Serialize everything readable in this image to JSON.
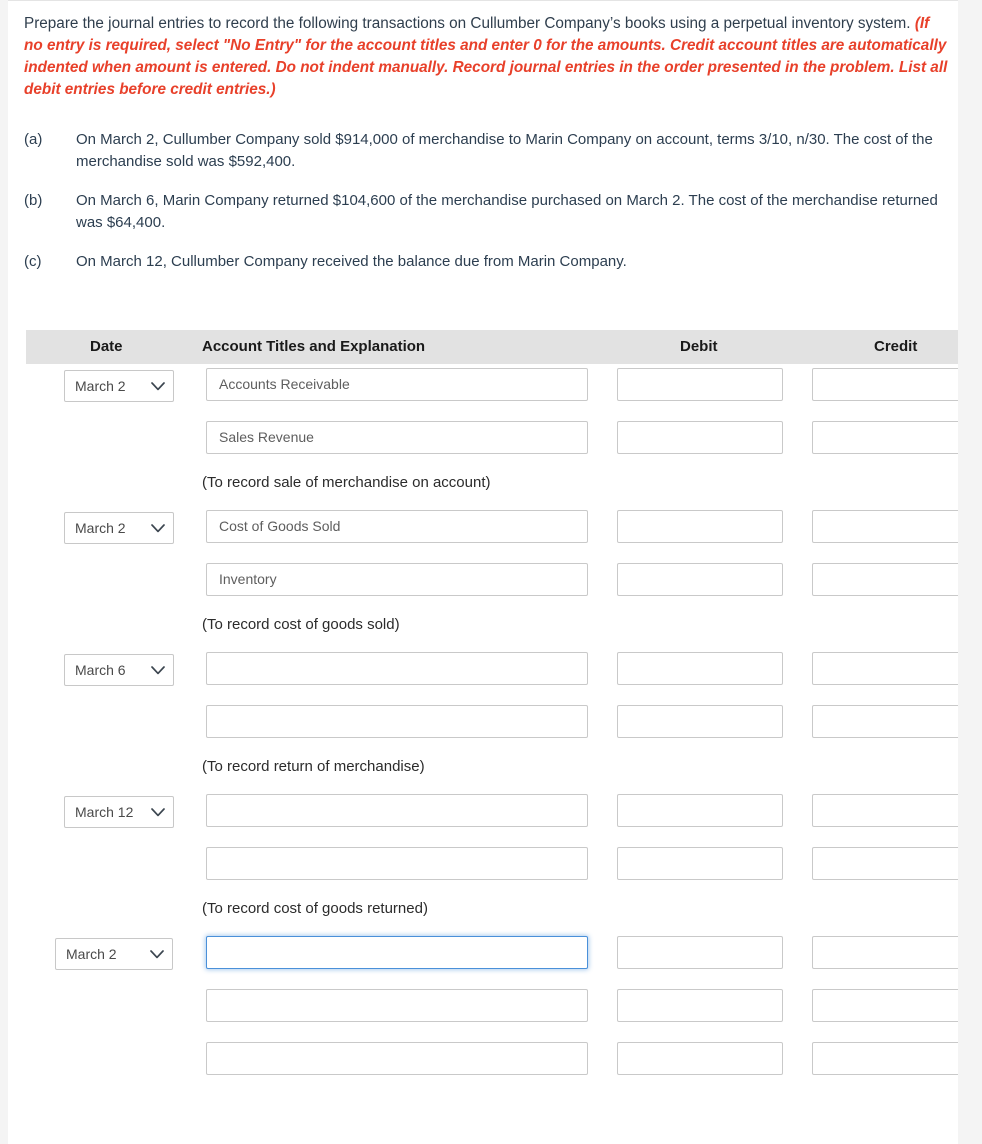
{
  "instructions": {
    "lead": "Prepare the journal entries to record the following transactions on Cullumber Company’s books using a perpetual inventory system.",
    "note": "(If no entry is required, select \"No Entry\" for the account titles and enter 0 for the amounts. Credit account titles are automatically indented when amount is entered. Do not indent manually. Record journal entries in the order presented in the problem. List all debit entries before credit entries.)"
  },
  "transactions": [
    {
      "label": "(a)",
      "text": "On March 2, Cullumber Company sold $914,000 of merchandise to Marin Company on account, terms 3/10, n/30. The cost of the merchandise sold was $592,400."
    },
    {
      "label": "(b)",
      "text": "On March 6, Marin Company returned $104,600 of the merchandise purchased on March 2. The cost of the merchandise returned was $64,400."
    },
    {
      "label": "(c)",
      "text": "On March 12, Cullumber Company received the balance due from Marin Company."
    }
  ],
  "journal": {
    "headers": {
      "date": "Date",
      "account": "Account Titles and Explanation",
      "debit": "Debit",
      "credit": "Credit"
    },
    "header_background": "#e2e2e2",
    "focus_color": "#4a90d9",
    "groups": [
      {
        "date": "March 2",
        "date_icon": "chevron-down-icon",
        "lines": [
          {
            "account": "Accounts Receivable",
            "debit": "",
            "credit": "",
            "focused": false
          },
          {
            "account": "Sales Revenue",
            "debit": "",
            "credit": "",
            "focused": false
          }
        ],
        "explanation": "(To record sale of merchandise on account)"
      },
      {
        "date": "March 2",
        "date_icon": "chevron-down-icon",
        "lines": [
          {
            "account": "Cost of Goods Sold",
            "debit": "",
            "credit": "",
            "focused": false
          },
          {
            "account": "Inventory",
            "debit": "",
            "credit": "",
            "focused": false
          }
        ],
        "explanation": "(To record cost of goods sold)"
      },
      {
        "date": "March 6",
        "date_icon": "chevron-down-icon",
        "lines": [
          {
            "account": "",
            "debit": "",
            "credit": "",
            "focused": false
          },
          {
            "account": "",
            "debit": "",
            "credit": "",
            "focused": false
          }
        ],
        "explanation": "(To record return of merchandise)"
      },
      {
        "date": "March 12",
        "date_icon": "chevron-down-icon",
        "lines": [
          {
            "account": "",
            "debit": "",
            "credit": "",
            "focused": false
          },
          {
            "account": "",
            "debit": "",
            "credit": "",
            "focused": false
          }
        ],
        "explanation": "(To record cost of goods returned)"
      },
      {
        "date": "March 2",
        "date_icon": "chevron-down-icon",
        "wide_date": true,
        "lines": [
          {
            "account": "",
            "debit": "",
            "credit": "",
            "focused": true
          },
          {
            "account": "",
            "debit": "",
            "credit": "",
            "focused": false
          },
          {
            "account": "",
            "debit": "",
            "credit": "",
            "focused": false
          }
        ],
        "explanation": ""
      }
    ]
  }
}
